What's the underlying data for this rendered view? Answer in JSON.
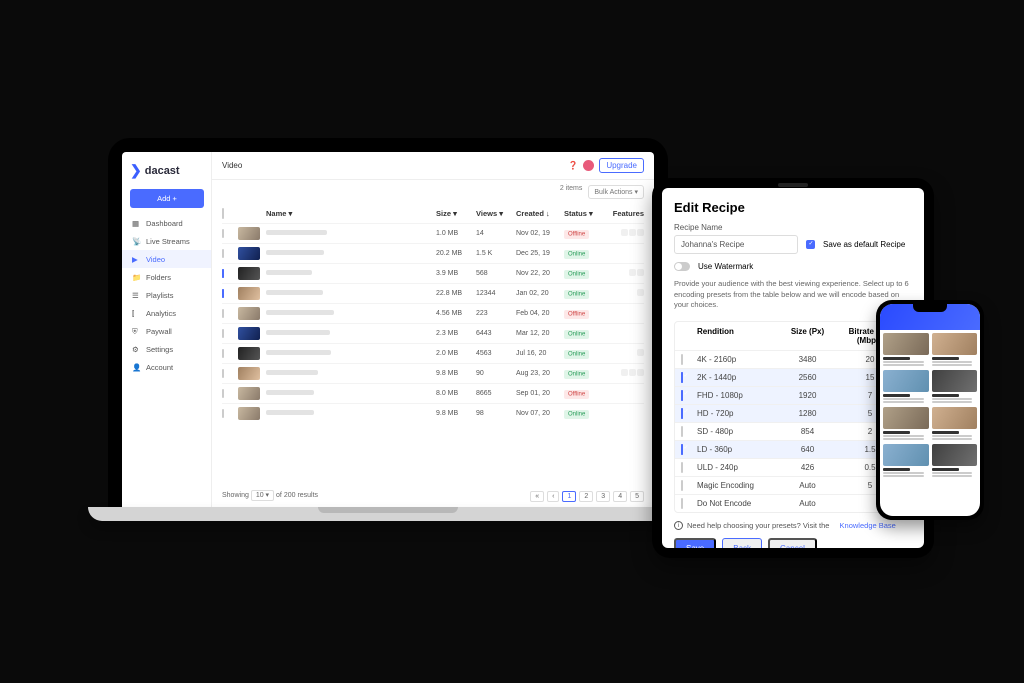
{
  "brand": "dacast",
  "sidebar": {
    "add": "Add +",
    "items": [
      "Dashboard",
      "Live Streams",
      "Video",
      "Folders",
      "Playlists",
      "Analytics",
      "Paywall",
      "Settings",
      "Account"
    ],
    "activeIndex": 2
  },
  "topbar": {
    "title": "Video",
    "upgrade": "Upgrade"
  },
  "bulk": {
    "count": "2 items",
    "actions": "Bulk Actions"
  },
  "columns": {
    "name": "Name",
    "size": "Size",
    "views": "Views",
    "created": "Created",
    "status": "Status",
    "features": "Features"
  },
  "rows": [
    {
      "checked": false,
      "size": "1.0 MB",
      "views": "14",
      "created": "Nov 02, 19",
      "status": "Offline",
      "icons": 3
    },
    {
      "checked": false,
      "size": "20.2 MB",
      "views": "1.5 K",
      "created": "Dec 25, 19",
      "status": "Online",
      "icons": 0
    },
    {
      "checked": true,
      "size": "3.9 MB",
      "views": "568",
      "created": "Nov 22, 20",
      "status": "Online",
      "icons": 2
    },
    {
      "checked": true,
      "size": "22.8 MB",
      "views": "12344",
      "created": "Jan 02, 20",
      "status": "Online",
      "icons": 1
    },
    {
      "checked": false,
      "size": "4.56 MB",
      "views": "223",
      "created": "Feb 04, 20",
      "status": "Offline",
      "icons": 0
    },
    {
      "checked": false,
      "size": "2.3 MB",
      "views": "6443",
      "created": "Mar 12, 20",
      "status": "Online",
      "icons": 0
    },
    {
      "checked": false,
      "size": "2.0 MB",
      "views": "4563",
      "created": "Jul 16, 20",
      "status": "Online",
      "icons": 1
    },
    {
      "checked": false,
      "size": "9.8 MB",
      "views": "90",
      "created": "Aug 23, 20",
      "status": "Online",
      "icons": 3
    },
    {
      "checked": false,
      "size": "8.0 MB",
      "views": "8665",
      "created": "Sep 01, 20",
      "status": "Offline",
      "icons": 0
    },
    {
      "checked": false,
      "size": "9.8 MB",
      "views": "98",
      "created": "Nov 07, 20",
      "status": "Online",
      "icons": 0
    }
  ],
  "pagination": {
    "showing": "Showing",
    "perLabel": "10",
    "of": "of 200 results",
    "pages": [
      "1",
      "2",
      "3",
      "4",
      "5"
    ]
  },
  "recipe": {
    "title": "Edit Recipe",
    "nameLabel": "Recipe Name",
    "nameValue": "Johanna's Recipe",
    "saveDefault": "Save as default Recipe",
    "watermark": "Use Watermark",
    "help": "Provide your audience with the best viewing experience. Select up to 6 encoding presets from the table below and we will encode based on your choices.",
    "cols": {
      "rendition": "Rendition",
      "size": "Size (Px)",
      "bitrate": "Bitrate Cap (Mbps)"
    },
    "presets": [
      {
        "checked": false,
        "name": "4K - 2160p",
        "size": "3480",
        "bitrate": "20"
      },
      {
        "checked": true,
        "name": "2K - 1440p",
        "size": "2560",
        "bitrate": "15"
      },
      {
        "checked": true,
        "name": "FHD - 1080p",
        "size": "1920",
        "bitrate": "7"
      },
      {
        "checked": true,
        "name": "HD - 720p",
        "size": "1280",
        "bitrate": "5"
      },
      {
        "checked": false,
        "name": "SD - 480p",
        "size": "854",
        "bitrate": "2"
      },
      {
        "checked": true,
        "name": "LD - 360p",
        "size": "640",
        "bitrate": "1.5"
      },
      {
        "checked": false,
        "name": "ULD - 240p",
        "size": "426",
        "bitrate": "0.5"
      },
      {
        "checked": false,
        "name": "Magic Encoding",
        "size": "Auto",
        "bitrate": "5"
      },
      {
        "checked": false,
        "name": "Do Not Encode",
        "size": "Auto",
        "bitrate": ""
      }
    ],
    "infoText": "Need help choosing your presets? Visit the",
    "infoLink": "Knowledge Base",
    "save": "Save",
    "back": "Back",
    "cancel": "Cancel"
  }
}
